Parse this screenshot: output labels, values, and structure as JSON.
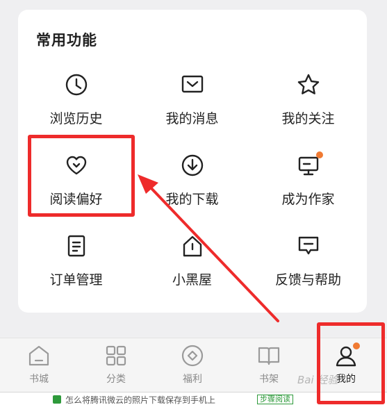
{
  "section": {
    "title": "常用功能",
    "items": [
      {
        "label": "浏览历史",
        "icon": "clock-icon"
      },
      {
        "label": "我的消息",
        "icon": "message-envelope-icon"
      },
      {
        "label": "我的关注",
        "icon": "star-icon"
      },
      {
        "label": "阅读偏好",
        "icon": "heart-icon"
      },
      {
        "label": "我的下载",
        "icon": "download-icon"
      },
      {
        "label": "成为作家",
        "icon": "monitor-icon",
        "badge": true
      },
      {
        "label": "订单管理",
        "icon": "document-icon"
      },
      {
        "label": "小黑屋",
        "icon": "house-icon"
      },
      {
        "label": "反馈与帮助",
        "icon": "chat-bubble-icon"
      }
    ]
  },
  "tabbar": {
    "items": [
      {
        "label": "书城",
        "icon": "home-icon",
        "active": false
      },
      {
        "label": "分类",
        "icon": "grid-icon",
        "active": false
      },
      {
        "label": "福利",
        "icon": "diamond-circle-icon",
        "active": false
      },
      {
        "label": "书架",
        "icon": "book-icon",
        "active": false
      },
      {
        "label": "我的",
        "icon": "user-icon",
        "active": true,
        "badge": true
      }
    ]
  },
  "bottom_strip": {
    "text": "怎么将腾讯微云的照片下载保存到手机上",
    "badge": "步骤阅读"
  },
  "watermark": "Bai 经验",
  "colors": {
    "accent_dot": "#f07a32",
    "highlight": "#ee2b2b",
    "card_bg": "#ffffff",
    "page_bg": "#efeff1"
  }
}
